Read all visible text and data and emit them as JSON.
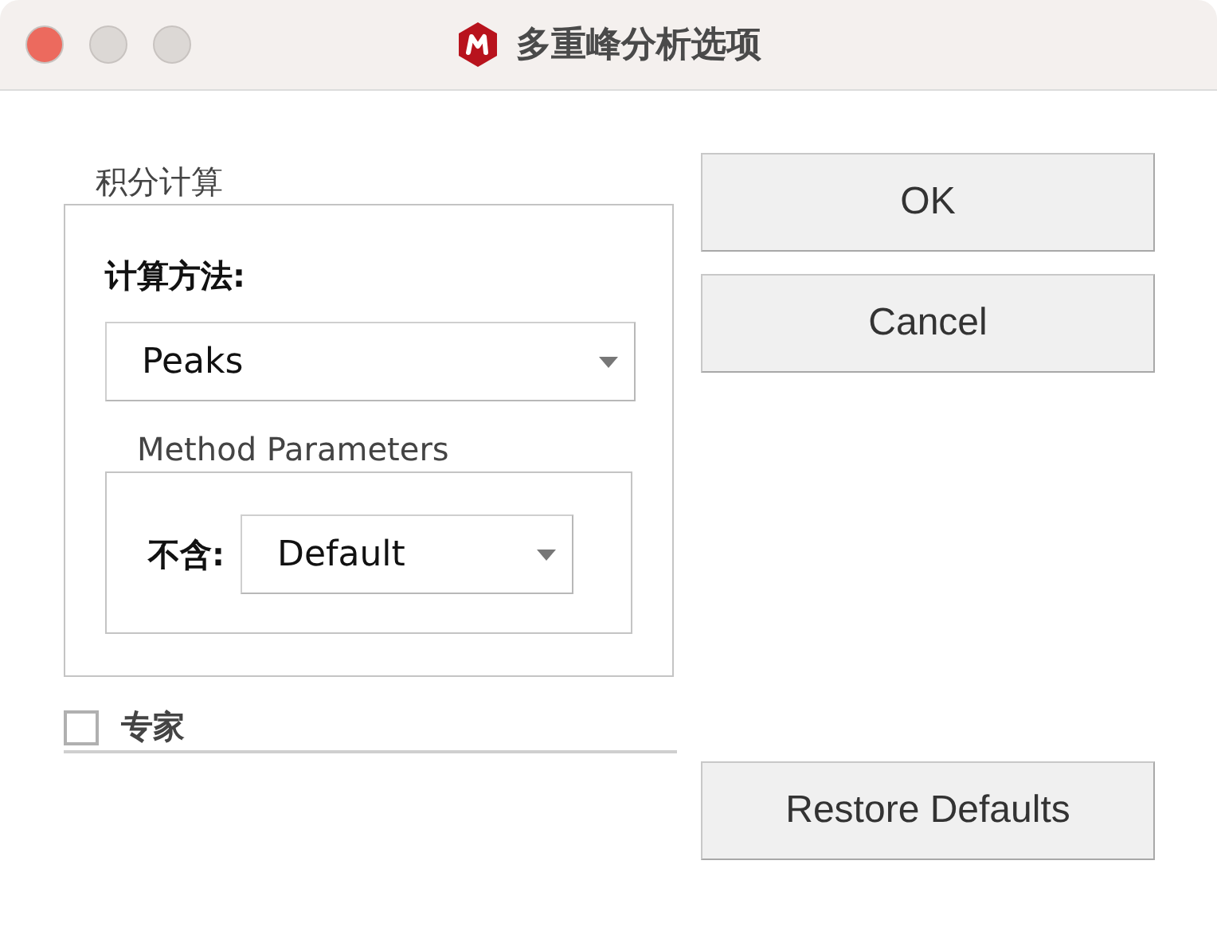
{
  "window": {
    "title": "多重峰分析选项"
  },
  "integration": {
    "legend": "积分计算",
    "method_label": "计算方法:",
    "method": {
      "value": "Peaks"
    },
    "parameters": {
      "legend": "Method Parameters",
      "exclude_label": "不含:",
      "exclude": {
        "value": "Default"
      }
    }
  },
  "expert": {
    "label": "专家",
    "checked": false
  },
  "buttons": [
    {
      "label": "OK"
    },
    {
      "label": "Cancel"
    },
    {
      "label": "Restore Defaults"
    }
  ]
}
